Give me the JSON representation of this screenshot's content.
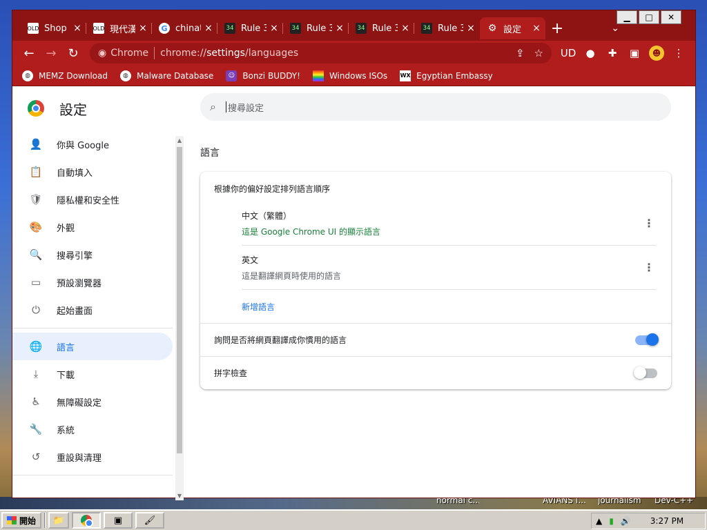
{
  "desktop": {
    "items": [
      "normal c...",
      "AVIANS I...",
      "journalism",
      "Dev-C++"
    ]
  },
  "window": {
    "controls": {
      "minimize": "▁",
      "maximize": "□",
      "close": "✕"
    }
  },
  "tabs": [
    {
      "title": "Shop",
      "favicon": "OLD",
      "favicon_style": "plain"
    },
    {
      "title": "現代漢",
      "favicon": "OLD",
      "favicon_style": "plain"
    },
    {
      "title": "chinat",
      "favicon": "G",
      "favicon_style": "g"
    },
    {
      "title": "Rule 3",
      "favicon": "34",
      "favicon_style": "dark"
    },
    {
      "title": "Rule 3",
      "favicon": "34",
      "favicon_style": "dark"
    },
    {
      "title": "Rule 3",
      "favicon": "34",
      "favicon_style": "dark"
    },
    {
      "title": "Rule 3",
      "favicon": "34",
      "favicon_style": "dark"
    },
    {
      "title": "設定",
      "favicon": "⚙",
      "favicon_style": "gear",
      "active": true
    }
  ],
  "tab_close": "×",
  "new_tab": "+",
  "tab_search": "⌄",
  "toolbar": {
    "back": "←",
    "forward": "→",
    "reload": "↻",
    "chip_label": "Chrome",
    "url_scheme": "chrome://",
    "url_host": "settings",
    "url_path": "/languages",
    "share": "⇪",
    "bookmark_star": "☆",
    "extensions": [
      "UD",
      "●",
      "✚",
      "▣"
    ],
    "menu": "⋮"
  },
  "bookmarks": [
    {
      "label": "MEMZ Download",
      "icon": "globe"
    },
    {
      "label": "Malware Database",
      "icon": "globe"
    },
    {
      "label": "Bonzi BUDDY!",
      "icon": "bonzi"
    },
    {
      "label": "Windows ISOs",
      "icon": "rainbow"
    },
    {
      "label": "Egyptian Embassy",
      "icon": "wix"
    }
  ],
  "sidebar": {
    "title": "設定",
    "items": [
      {
        "label": "你與 Google",
        "icon": "person-icon",
        "glyph": "👤"
      },
      {
        "label": "自動填入",
        "icon": "clipboard-icon",
        "glyph": "📋"
      },
      {
        "label": "隱私權和安全性",
        "icon": "shield-icon",
        "glyph": "🛡"
      },
      {
        "label": "外觀",
        "icon": "palette-icon",
        "glyph": "🎨"
      },
      {
        "label": "搜尋引擎",
        "icon": "search-icon",
        "glyph": "🔍"
      },
      {
        "label": "預設瀏覽器",
        "icon": "browser-icon",
        "glyph": "▭"
      },
      {
        "label": "起始畫面",
        "icon": "power-icon",
        "glyph": "⏻"
      },
      {
        "label": "語言",
        "icon": "globe-icon",
        "glyph": "🌐",
        "active": true
      },
      {
        "label": "下載",
        "icon": "download-icon",
        "glyph": "⤓"
      },
      {
        "label": "無障礙設定",
        "icon": "accessibility-icon",
        "glyph": "♿"
      },
      {
        "label": "系統",
        "icon": "wrench-icon",
        "glyph": "🔧"
      },
      {
        "label": "重設與清理",
        "icon": "restore-icon",
        "glyph": "↺"
      }
    ]
  },
  "search": {
    "placeholder": "搜尋設定"
  },
  "languages_section": {
    "title": "語言",
    "order_header": "根據你的偏好設定排列語言順序",
    "languages": [
      {
        "name": "中文（繁體）",
        "sub": "這是 Google Chrome UI 的顯示語言",
        "sub_color": "#188038"
      },
      {
        "name": "英文",
        "sub": "這是翻譯網頁時使用的語言",
        "sub_color": "#5f6368"
      }
    ],
    "add_language": "新增語言",
    "offer_translate": {
      "label": "詢問是否將網頁翻譯成你慣用的語言",
      "enabled": true
    },
    "spell_check": {
      "label": "拼字檢查",
      "enabled": false
    }
  },
  "taskbar": {
    "start_label": "開始",
    "clock": "3:27 PM"
  },
  "colors": {
    "frame": "#b11c1c",
    "accent": "#1a73e8"
  }
}
